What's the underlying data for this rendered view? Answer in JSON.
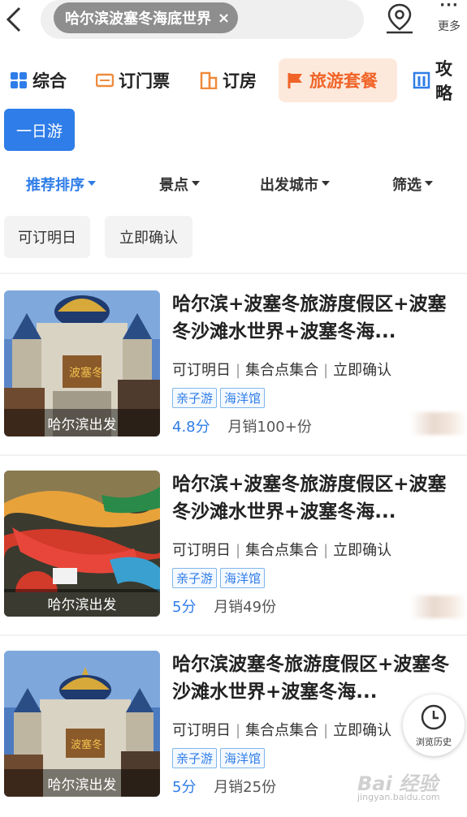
{
  "search": {
    "chip_text": "哈尔滨波塞冬海底世界",
    "clear_glyph": "×"
  },
  "header": {
    "more_label": "更多"
  },
  "categories": [
    {
      "label": "综合",
      "icon": "grid-icon",
      "color": "#2f7de8"
    },
    {
      "label": "订门票",
      "icon": "ticket-icon",
      "color": "#f08a3c"
    },
    {
      "label": "订房",
      "icon": "hotel-icon",
      "color": "#f08a3c"
    },
    {
      "label": "旅游套餐",
      "icon": "flag-icon",
      "color": "#f06428",
      "active": true
    },
    {
      "label": "攻略",
      "icon": "guide-icon",
      "color": "#2f7de8"
    }
  ],
  "subfilter": {
    "label": "一日游"
  },
  "filters": [
    {
      "label": "推荐排序",
      "active": true
    },
    {
      "label": "景点"
    },
    {
      "label": "出发城市"
    },
    {
      "label": "筛选"
    }
  ],
  "quick_tags": [
    "可订明日",
    "立即确认"
  ],
  "products": [
    {
      "title": "哈尔滨+波塞冬旅游度假区+波塞冬沙滩水世界+波塞冬海...",
      "meta": [
        "可订明日",
        "集合点集合",
        "立即确认"
      ],
      "tags": [
        "亲子游",
        "海洋馆"
      ],
      "score": "4.8分",
      "sales": "月销100+份",
      "depart": "哈尔滨出发",
      "image": "castle"
    },
    {
      "title": "哈尔滨+波塞冬旅游度假区+波塞冬沙滩水世界+波塞冬海...",
      "meta": [
        "可订明日",
        "集合点集合",
        "立即确认"
      ],
      "tags": [
        "亲子游",
        "海洋馆"
      ],
      "score": "5分",
      "sales": "月销49份",
      "depart": "哈尔滨出发",
      "image": "waterslide"
    },
    {
      "title": "哈尔滨波塞冬旅游度假区+波塞冬沙滩水世界+波塞冬海...",
      "meta": [
        "可订明日",
        "集合点集合",
        "立即确认"
      ],
      "tags": [
        "亲子游",
        "海洋馆"
      ],
      "score": "5分",
      "sales": "月销25份",
      "depart": "哈尔滨出发",
      "image": "castle"
    }
  ],
  "history": {
    "label": "浏览历史"
  },
  "watermark": {
    "text": "Bai 经验",
    "sub": "jingyan.baidu.com"
  },
  "colors": {
    "accent_blue": "#2f7de8",
    "accent_orange": "#f06428"
  }
}
